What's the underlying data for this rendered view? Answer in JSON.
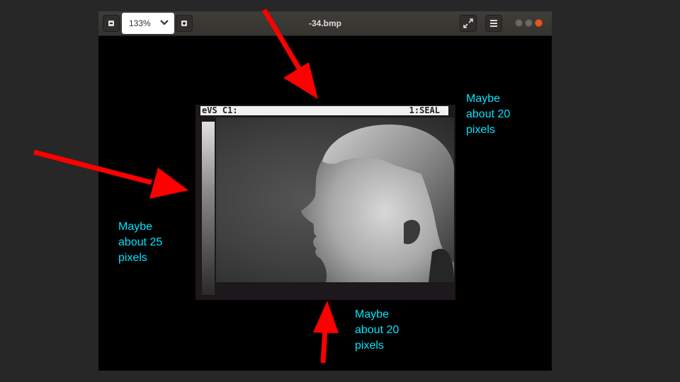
{
  "window": {
    "title": "-34.bmp",
    "zoom": "133%"
  },
  "image": {
    "overlay_left": "eVS C1:",
    "overlay_right": "1:SEAL"
  },
  "annotations": {
    "top_right": "Maybe\nabout 20\npixels",
    "left": "Maybe\nabout 25\npixels",
    "bottom": "Maybe\nabout 20\npixels"
  },
  "colors": {
    "annotation": "#00e5ff",
    "arrow": "#ff0000"
  }
}
